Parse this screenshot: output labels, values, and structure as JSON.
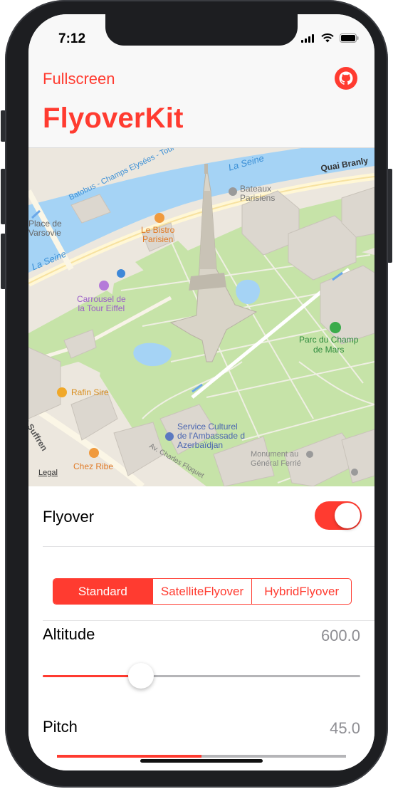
{
  "status": {
    "time": "7:12"
  },
  "nav": {
    "left_button": "Fullscreen",
    "right_icon": "github-icon",
    "title": "FlyoverKit"
  },
  "map": {
    "labels": {
      "seine_1": "La Seine",
      "seine_2": "La Seine",
      "quai": "Quai Branly",
      "batobus": "Batobus - Champs Elysées - Tour Eiffel",
      "bateaux_1": "Bateaux",
      "bateaux_2": "Parisiens",
      "bistro_1": "Le Bistro",
      "bistro_2": "Parisien",
      "place_1": "Place de",
      "place_2": "Varsovie",
      "carrousel_1": "Carrousel de",
      "carrousel_2": "la Tour Eiffel",
      "parc_1": "Parc du Champ",
      "parc_2": "de Mars",
      "rafin": "Rafin Sire",
      "suffren": "de Suffren",
      "service_1": "Service Culturel",
      "service_2": "de l'Ambassade d",
      "service_3": "Azerbaïdjan",
      "monument_1": "Monument au",
      "monument_2": "Général Ferrié",
      "charles": "Av. Charles Floquet",
      "chez": "Chez Ribe",
      "legal": "Legal"
    }
  },
  "controls": {
    "flyover": {
      "label": "Flyover",
      "on": true
    },
    "segments": [
      "Standard",
      "SatelliteFlyover",
      "HybridFlyover"
    ],
    "selected_segment": "Standard",
    "altitude": {
      "label": "Altitude",
      "value": "600.0",
      "slider_fraction": 0.31
    },
    "pitch": {
      "label": "Pitch",
      "value": "45.0",
      "slider_fraction": 0.5
    }
  },
  "colors": {
    "accent": "#ff3b30",
    "park": "#c6e3a8",
    "water": "#a5d3f5"
  }
}
